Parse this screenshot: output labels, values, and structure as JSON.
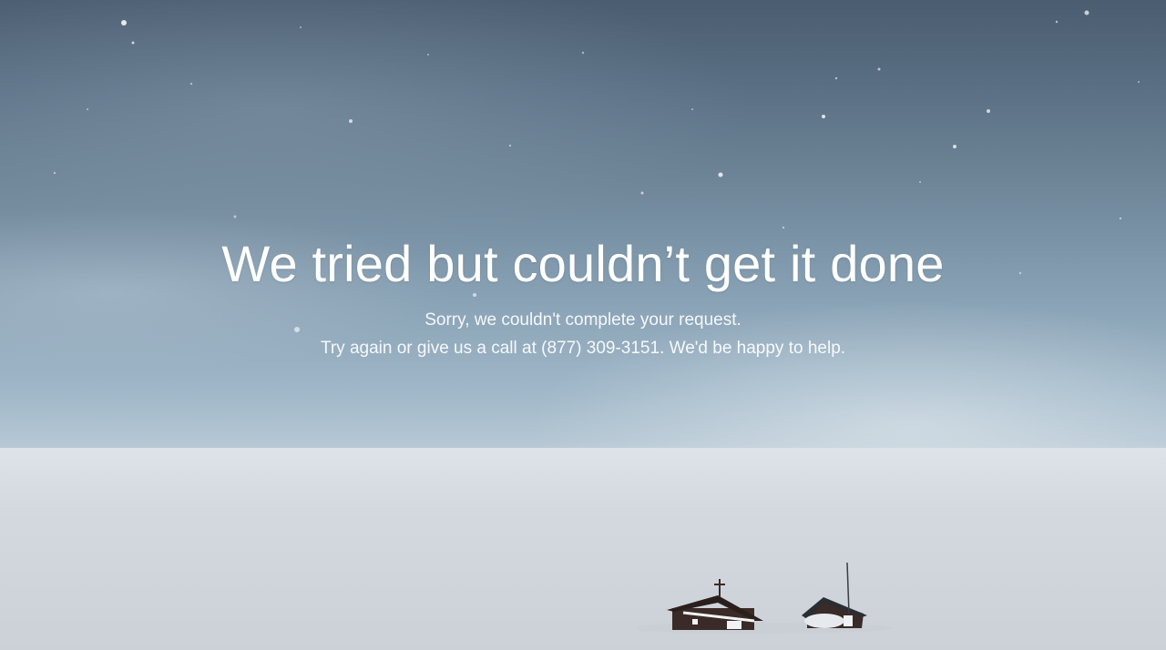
{
  "error_page": {
    "headline": "We tried but couldn’t get it done",
    "message_line_1": "Sorry, we couldn't complete your request.",
    "message_line_2": "Try again or give us a call at (877) 309-3151. We'd be happy to help."
  },
  "background": {
    "scene": "snowy-landscape-with-cabins",
    "sky_color_top": "#4b5d70",
    "sky_color_bottom": "#b4c6d3",
    "snow_color": "#d3d9df"
  }
}
